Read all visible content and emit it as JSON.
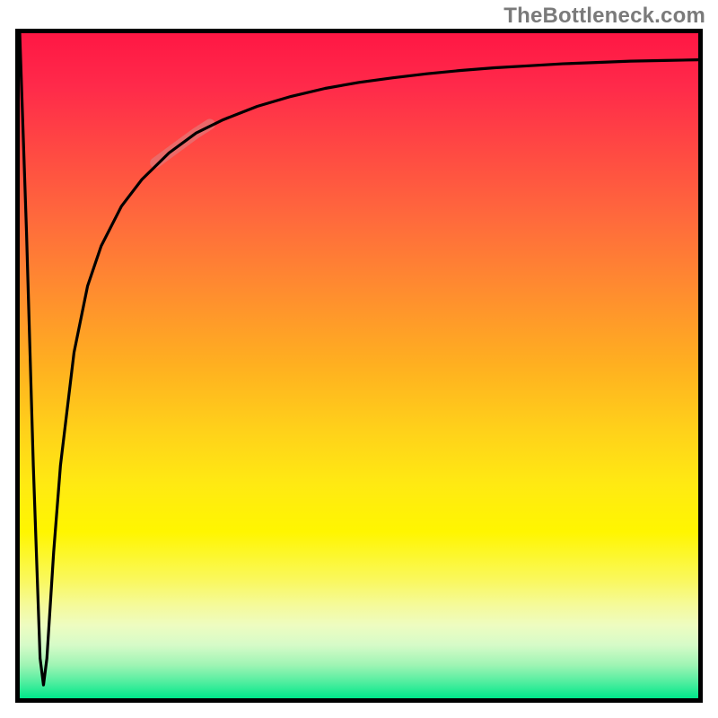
{
  "watermark": "TheBottleneck.com",
  "chart_data": {
    "type": "line",
    "title": "",
    "xlabel": "",
    "ylabel": "",
    "xlim": [
      0,
      100
    ],
    "ylim": [
      0,
      100
    ],
    "grid": false,
    "legend": false,
    "annotations": [
      {
        "text": "TheBottleneck.com",
        "position": "top-right"
      }
    ],
    "series": [
      {
        "name": "bottleneck-curve",
        "color": "#000000",
        "x": [
          0,
          1,
          2,
          3,
          3.5,
          4,
          5,
          6,
          8,
          10,
          12,
          15,
          18,
          22,
          26,
          30,
          35,
          40,
          45,
          50,
          55,
          60,
          65,
          70,
          75,
          80,
          85,
          90,
          95,
          100
        ],
        "y": [
          100,
          70,
          35,
          6,
          2,
          6,
          22,
          35,
          52,
          62,
          68,
          74,
          78,
          82,
          85,
          87,
          89,
          90.5,
          91.7,
          92.6,
          93.3,
          93.9,
          94.4,
          94.8,
          95.1,
          95.4,
          95.6,
          95.8,
          95.9,
          96
        ]
      },
      {
        "name": "highlight-segment",
        "color": "rgba(229,115,115,0.78)",
        "stroke_width": 12,
        "x": [
          20,
          22,
          24,
          26,
          28
        ],
        "y": [
          80.5,
          82,
          83.5,
          85,
          86.3
        ]
      }
    ],
    "background_gradient_stops": [
      {
        "pos": 0.0,
        "color": "#ff1744"
      },
      {
        "pos": 0.5,
        "color": "#ffb020"
      },
      {
        "pos": 0.75,
        "color": "#fff600"
      },
      {
        "pos": 1.0,
        "color": "#00e88a"
      }
    ]
  }
}
